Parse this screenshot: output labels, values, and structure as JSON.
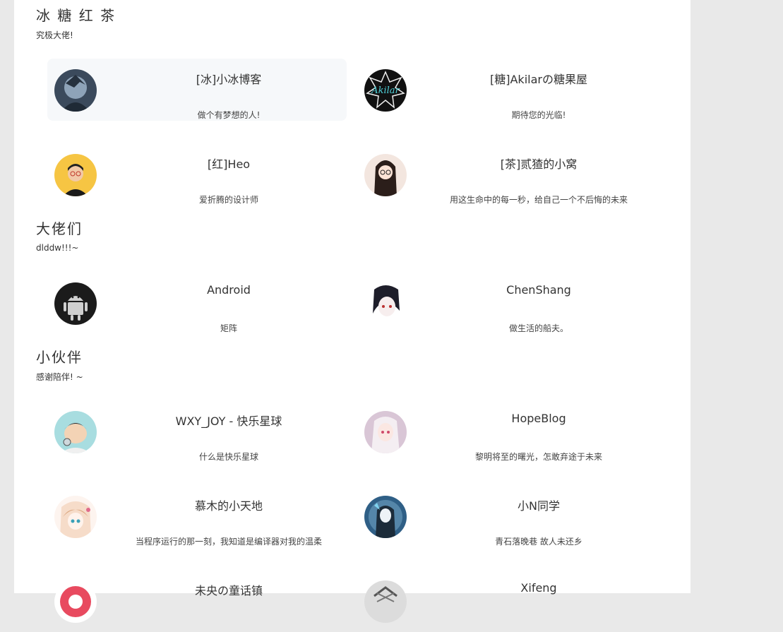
{
  "groups": [
    {
      "title": "冰 糖 红 茶",
      "desc": "究极大佬!",
      "links": [
        {
          "name": "[冰]小冰博客",
          "desc": "做个有梦想的人!",
          "avatar_bg": "#3b4a5c",
          "avatar_accent": "#8ea3b8",
          "hovered": true
        },
        {
          "name": "[糖]Akilarの糖果屋",
          "desc": "期待您的光临!",
          "avatar_bg": "#111111",
          "avatar_accent": "#4fd1d9",
          "avatar_text": "Akilar"
        },
        {
          "name": "[红]Heo",
          "desc": "爱折腾的设计师",
          "avatar_bg": "#f6c543",
          "avatar_accent": "#222222"
        },
        {
          "name": "[茶]贰猹的小窝",
          "desc": "用这生命中的每一秒，给自己一个不后悔的未来",
          "avatar_bg": "#f3e6df",
          "avatar_accent": "#2b1e1a"
        }
      ]
    },
    {
      "title": "大佬们",
      "desc": "dlddw!!!~",
      "links": [
        {
          "name": "Android",
          "desc": "矩阵",
          "avatar_bg": "#1b1b1b",
          "avatar_accent": "#cfcfcf"
        },
        {
          "name": "ChenShang",
          "desc": "做生活的船夫。",
          "avatar_bg": "#ffffff",
          "avatar_accent": "#1e1e2a"
        }
      ]
    },
    {
      "title": "小伙伴",
      "desc": "感谢陪伴! ~",
      "links": [
        {
          "name": "WXY_JOY - 快乐星球",
          "desc": "什么是快乐星球",
          "avatar_bg": "#a8dde0",
          "avatar_accent": "#2d2d2d"
        },
        {
          "name": "HopeBlog",
          "desc": "黎明将至的曙光，怎敢弃途于未来",
          "avatar_bg": "#d9c6d6",
          "avatar_accent": "#f4eef2"
        },
        {
          "name": "慕木的小天地",
          "desc": "当程序运行的那一刻，我知道是编译器对我的温柔",
          "avatar_bg": "#f6dcc9",
          "avatar_accent": "#d9a37a"
        },
        {
          "name": "小N同学",
          "desc": "青石落晚巷 故人未还乡",
          "avatar_bg": "#2f5f86",
          "avatar_accent": "#9fd0ea"
        },
        {
          "name": "未央の童话镇",
          "desc": "",
          "avatar_bg": "#e84a5f",
          "avatar_accent": "#ffffff"
        },
        {
          "name": "Xifeng",
          "desc": "",
          "avatar_bg": "#dcdcdc",
          "avatar_accent": "#555555"
        }
      ]
    }
  ]
}
